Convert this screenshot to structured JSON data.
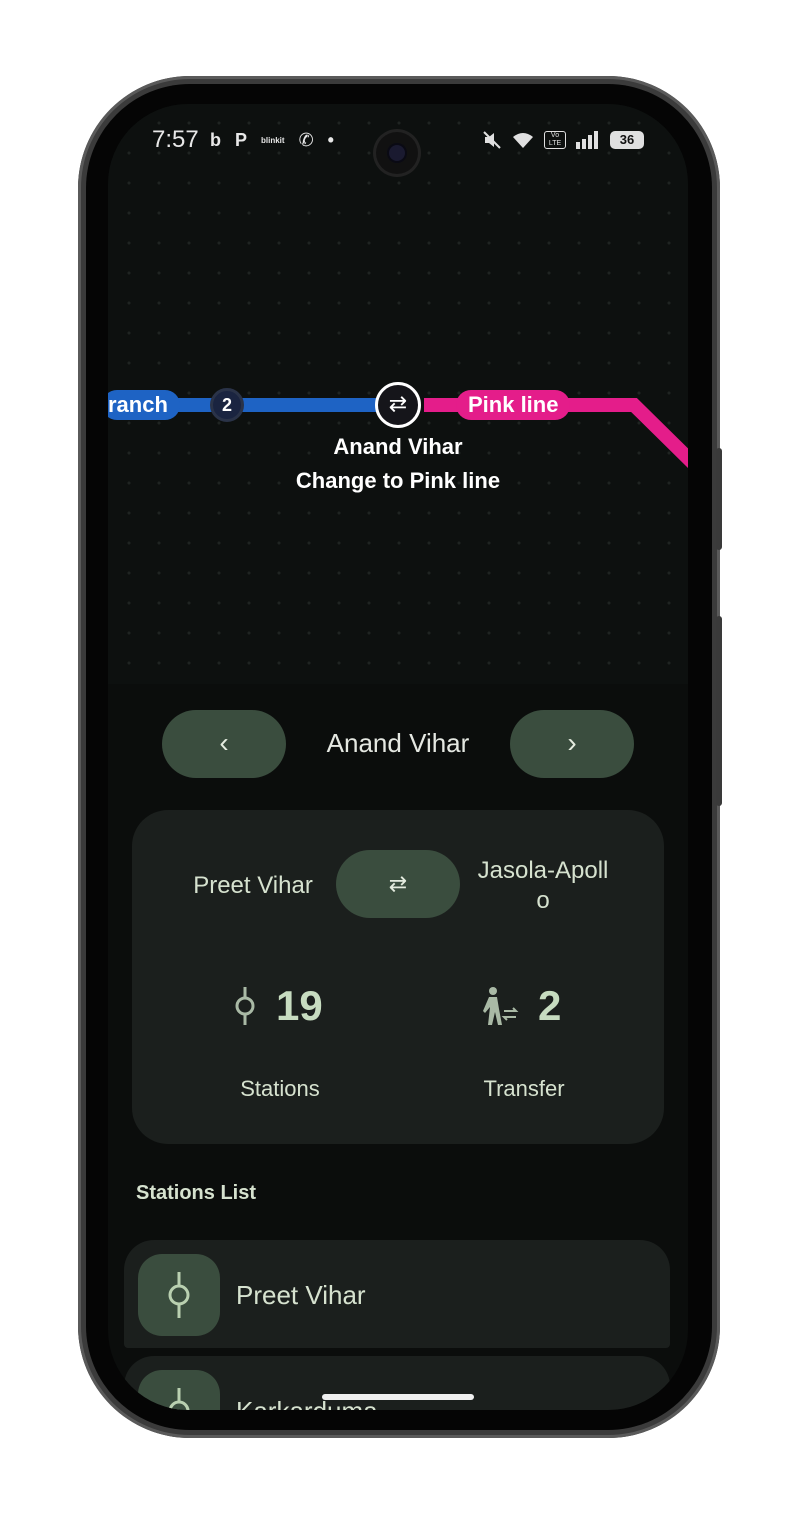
{
  "status_bar": {
    "time": "7:57",
    "left_icons": [
      "b",
      "P",
      "blinkit",
      "✆",
      "•"
    ],
    "battery": "36",
    "volte": "Vo LTE"
  },
  "map": {
    "left_branch_label": "ranch",
    "stop_count_label": "2",
    "interchange_icon": "⇄",
    "next_line_label": "Pink line",
    "station_name": "Anand Vihar",
    "instruction": "Change to Pink line",
    "colors": {
      "blue_line": "#1e63c4",
      "pink_line": "#e41d8a"
    }
  },
  "nav": {
    "prev_icon": "‹",
    "next_icon": "›",
    "current_station": "Anand Vihar"
  },
  "route": {
    "from": "Preet Vihar",
    "to": "Jasola-Apoll o",
    "swap_icon": "⇄",
    "stations_count": "19",
    "stations_label": "Stations",
    "transfers_count": "2",
    "transfers_label": "Transfer"
  },
  "stations_list": {
    "title": "Stations List",
    "items": [
      {
        "name": "Preet Vihar",
        "icon": "station-icon"
      },
      {
        "name": "Karkarduma",
        "icon": "station-icon"
      }
    ]
  }
}
